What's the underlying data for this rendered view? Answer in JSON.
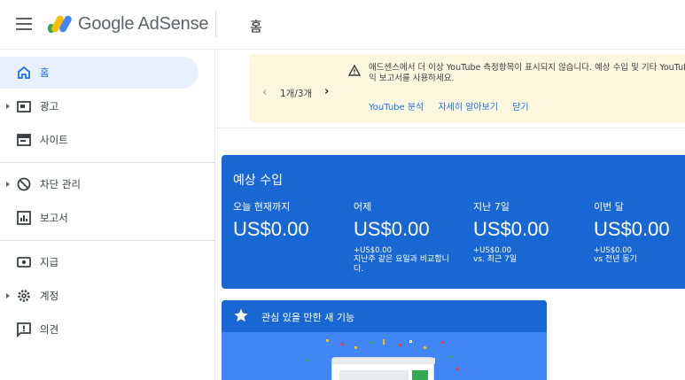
{
  "brand": {
    "name": "Google AdSense",
    "colors": {
      "yellow": "#fbbc04",
      "blue": "#4285f4"
    }
  },
  "header": {
    "page_title": "홈"
  },
  "sidebar": {
    "items": [
      {
        "label": "홈",
        "icon": "home-icon",
        "active": true
      },
      {
        "label": "광고",
        "icon": "ads-icon"
      },
      {
        "label": "사이트",
        "icon": "sites-icon"
      },
      {
        "label": "차단 관리",
        "icon": "block-icon"
      },
      {
        "label": "보고서",
        "icon": "reports-icon"
      },
      {
        "label": "지급",
        "icon": "payments-icon"
      },
      {
        "label": "계정",
        "icon": "gear-icon"
      },
      {
        "label": "의견",
        "icon": "feedback-icon"
      }
    ]
  },
  "notice": {
    "pager": "1개/3개",
    "message": "애드센스에서 더 이상 YouTube 측정항목이 표시되지 않습니다. 예상 수입 및 기타 YouTube 분석 수익 보고서를 사용하세요.",
    "links": [
      "YouTube 분석",
      "자세히 알아보기",
      "닫기"
    ]
  },
  "earnings": {
    "title": "예상 수입",
    "columns": [
      {
        "label": "오늘 현재까지",
        "value": "US$0.00",
        "delta": "",
        "compare": ""
      },
      {
        "label": "어제",
        "value": "US$0.00",
        "delta": "+US$0.00",
        "compare": "지난주 같은 요일과 비교합니다."
      },
      {
        "label": "지난 7일",
        "value": "US$0.00",
        "delta": "+US$0.00",
        "compare": "vs. 최근 7일"
      },
      {
        "label": "이번 달",
        "value": "US$0.00",
        "delta": "+US$0.00",
        "compare": "vs 전년 동기"
      }
    ]
  },
  "feature": {
    "title": "관심 있을 만한 새 기능"
  }
}
